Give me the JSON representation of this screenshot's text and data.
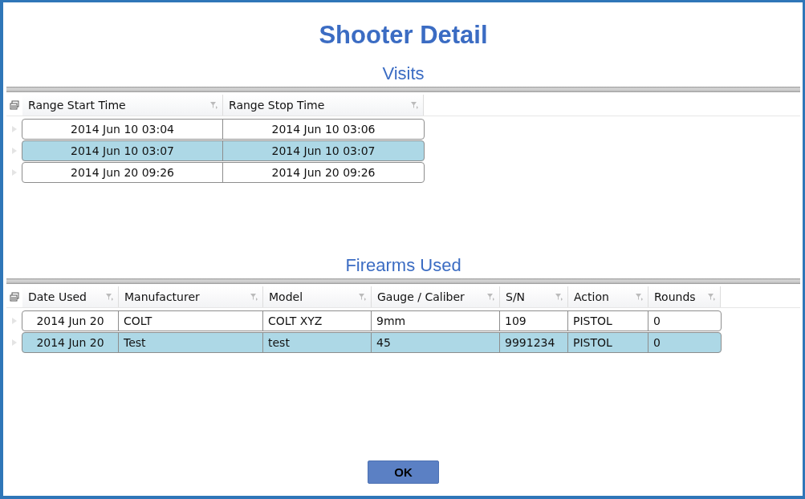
{
  "window": {
    "title": "Shooter Detail"
  },
  "visits": {
    "heading": "Visits",
    "columns": [
      "Range Start Time",
      "Range Stop Time"
    ],
    "rows": [
      {
        "cells": [
          "2014 Jun 10 03:04",
          "2014 Jun 10 03:06"
        ],
        "selected": false
      },
      {
        "cells": [
          "2014 Jun 10 03:07",
          "2014 Jun 10 03:07"
        ],
        "selected": true
      },
      {
        "cells": [
          "2014 Jun 20 09:26",
          "2014 Jun 20 09:26"
        ],
        "selected": false
      }
    ]
  },
  "firearms": {
    "heading": "Firearms Used",
    "columns": [
      "Date Used",
      "Manufacturer",
      "Model",
      "Gauge / Caliber",
      "S/N",
      "Action",
      "Rounds"
    ],
    "rows": [
      {
        "cells": [
          "2014 Jun 20",
          "COLT",
          "COLT XYZ",
          "9mm",
          "109",
          "PISTOL",
          "0"
        ],
        "selected": false
      },
      {
        "cells": [
          "2014 Jun 20",
          "Test",
          "test",
          "45",
          "9991234",
          "PISTOL",
          "0"
        ],
        "selected": true
      }
    ]
  },
  "buttons": [
    "OK"
  ]
}
